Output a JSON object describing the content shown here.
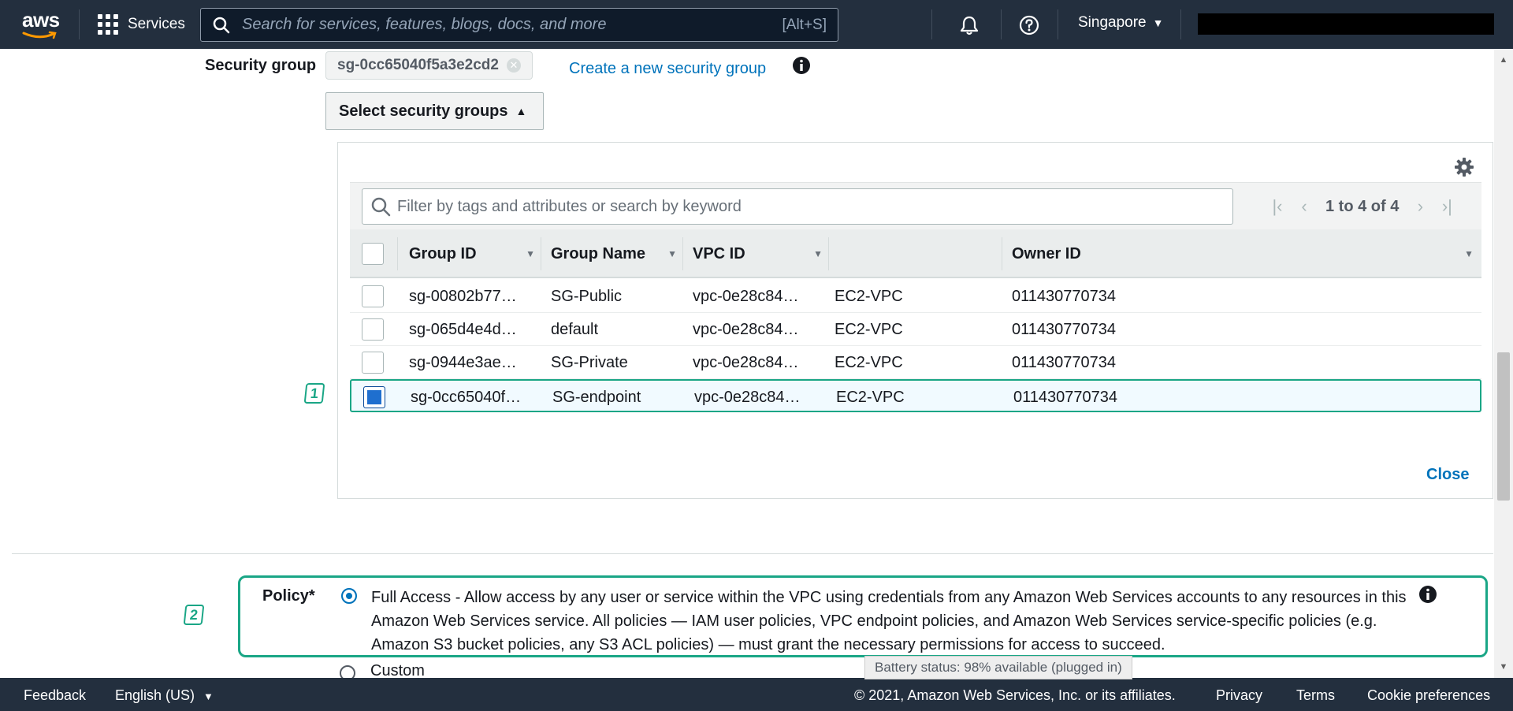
{
  "nav": {
    "logo_text": "aws",
    "services_label": "Services",
    "search_placeholder": "Search for services, features, blogs, docs, and more",
    "search_shortcut": "[Alt+S]",
    "region": "Singapore"
  },
  "security_group": {
    "label": "Security group",
    "selected_token": "sg-0cc65040f5a3e2cd2",
    "create_link": "Create a new security group",
    "select_button": "Select security groups"
  },
  "table": {
    "filter_placeholder": "Filter by tags and attributes or search by keyword",
    "pagination": "1 to 4 of 4",
    "columns": [
      "Group ID",
      "Group Name",
      "VPC ID",
      "",
      "Owner ID"
    ],
    "rows": [
      {
        "group_id": "sg-00802b77…",
        "group_name": "SG-Public",
        "vpc_id": "vpc-0e28c84…",
        "vpc_name": "EC2-VPC",
        "owner_id": "011430770734",
        "selected": false
      },
      {
        "group_id": "sg-065d4e4d…",
        "group_name": "default",
        "vpc_id": "vpc-0e28c84…",
        "vpc_name": "EC2-VPC",
        "owner_id": "011430770734",
        "selected": false
      },
      {
        "group_id": "sg-0944e3ae…",
        "group_name": "SG-Private",
        "vpc_id": "vpc-0e28c84…",
        "vpc_name": "EC2-VPC",
        "owner_id": "011430770734",
        "selected": false
      },
      {
        "group_id": "sg-0cc65040f…",
        "group_name": "SG-endpoint",
        "vpc_id": "vpc-0e28c84…",
        "vpc_name": "EC2-VPC",
        "owner_id": "011430770734",
        "selected": true
      }
    ],
    "close_label": "Close"
  },
  "annotations": {
    "step1": "1",
    "step2": "2"
  },
  "policy": {
    "label": "Policy*",
    "full_access_text": "Full Access - Allow access by any user or service within the VPC using credentials from any Amazon Web Services accounts to any resources in this Amazon Web Services service. All policies — IAM user policies, VPC endpoint policies, and Amazon Web Services service-specific policies (e.g. Amazon S3 bucket policies, any S3 ACL policies) — must grant the necessary permissions for access to succeed.",
    "custom_label": "Custom",
    "selected": "full_access"
  },
  "tooltip": "Battery status: 98% available (plugged in)",
  "footer": {
    "feedback": "Feedback",
    "language": "English (US)",
    "copyright": "© 2021, Amazon Web Services, Inc. or its affiliates.",
    "privacy": "Privacy",
    "terms": "Terms",
    "cookie": "Cookie preferences"
  },
  "colors": {
    "nav_bg": "#232f3e",
    "link": "#0073bb",
    "highlight": "#1aa686",
    "checkbox_selected": "#1f6fcf"
  }
}
